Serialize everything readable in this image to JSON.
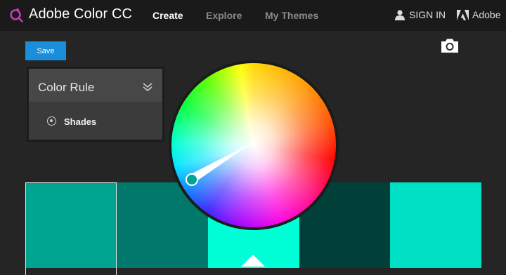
{
  "app": {
    "brand": "Adobe Color CC"
  },
  "nav": {
    "create": "Create",
    "explore": "Explore",
    "themes": "My Themes"
  },
  "account": {
    "signin": "SIGN IN",
    "adobe": "Adobe"
  },
  "toolbar": {
    "save": "Save"
  },
  "color_rule": {
    "title": "Color Rule",
    "option": "Shades"
  },
  "swatches": [
    {
      "color": "#00a591"
    },
    {
      "color": "#00786a"
    },
    {
      "color": "#00ffd7"
    },
    {
      "color": "#004038"
    },
    {
      "color": "#00e0c4"
    }
  ],
  "colors": {
    "accent": "#1a8ddb",
    "topbar": "#1a1a1a",
    "background": "#252525"
  }
}
